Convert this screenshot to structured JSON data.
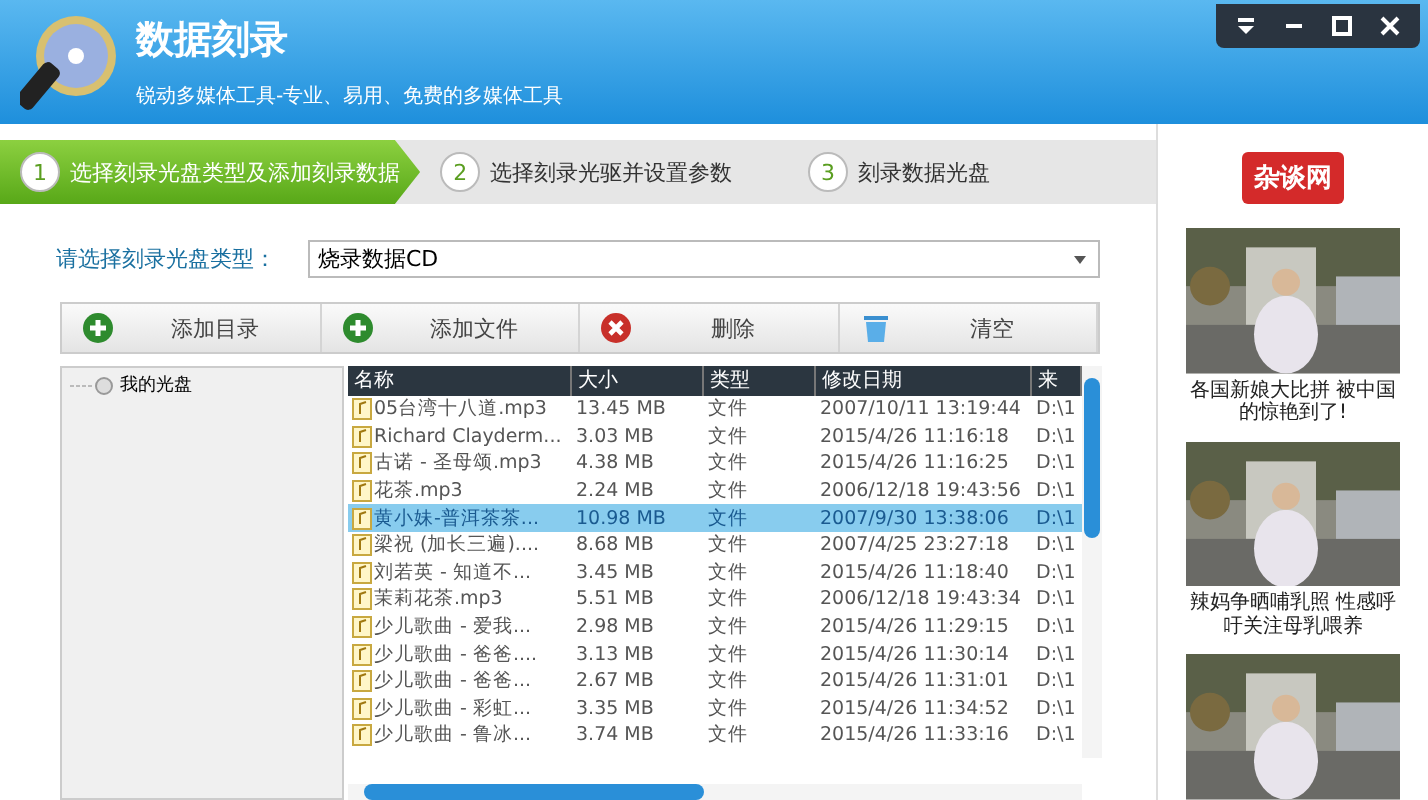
{
  "window": {
    "title": "数据刻录",
    "subtitle": "锐动多媒体工具-专业、易用、免费的多媒体工具"
  },
  "steps": [
    {
      "number": "1",
      "label": "选择刻录光盘类型及添加刻录数据",
      "selected": true
    },
    {
      "number": "2",
      "label": "选择刻录光驱并设置参数",
      "selected": false
    },
    {
      "number": "3",
      "label": "刻录数据光盘",
      "selected": false
    }
  ],
  "disc_type": {
    "label": "请选择刻录光盘类型：",
    "value": "烧录数据CD"
  },
  "toolbar": [
    {
      "kind": "add",
      "label": "添加目录"
    },
    {
      "kind": "add",
      "label": "添加文件"
    },
    {
      "kind": "delete",
      "label": "删除"
    },
    {
      "kind": "clear",
      "label": "清空"
    }
  ],
  "tree": {
    "items": [
      {
        "label": "我的光盘"
      }
    ]
  },
  "table": {
    "columns": [
      "名称",
      "大小",
      "类型",
      "修改日期",
      "来"
    ],
    "rows": [
      {
        "cells": [
          "05台湾十八道.mp3",
          "13.45 MB",
          "文件",
          "2007/10/11 13:19:44",
          "D:\\1"
        ],
        "selected": false
      },
      {
        "cells": [
          "Richard Clayderm...",
          "3.03 MB",
          "文件",
          "2015/4/26 11:16:18",
          "D:\\1"
        ],
        "selected": false
      },
      {
        "cells": [
          "古诺 - 圣母颂.mp3",
          "4.38 MB",
          "文件",
          "2015/4/26 11:16:25",
          "D:\\1"
        ],
        "selected": false
      },
      {
        "cells": [
          "花茶.mp3",
          "2.24 MB",
          "文件",
          "2006/12/18 19:43:56",
          "D:\\1"
        ],
        "selected": false
      },
      {
        "cells": [
          "黄小妹-普洱茶茶...",
          "10.98 MB",
          "文件",
          "2007/9/30 13:38:06",
          "D:\\1"
        ],
        "selected": true
      },
      {
        "cells": [
          "梁祝 (加长三遍)....",
          "8.68 MB",
          "文件",
          "2007/4/25 23:27:18",
          "D:\\1"
        ],
        "selected": false
      },
      {
        "cells": [
          "刘若英 - 知道不...",
          "3.45 MB",
          "文件",
          "2015/4/26 11:18:40",
          "D:\\1"
        ],
        "selected": false
      },
      {
        "cells": [
          "茉莉花茶.mp3",
          "5.51 MB",
          "文件",
          "2006/12/18 19:43:34",
          "D:\\1"
        ],
        "selected": false
      },
      {
        "cells": [
          "少儿歌曲 - 爱我...",
          "2.98 MB",
          "文件",
          "2015/4/26 11:29:15",
          "D:\\1"
        ],
        "selected": false
      },
      {
        "cells": [
          "少儿歌曲 - 爸爸....",
          "3.13 MB",
          "文件",
          "2015/4/26 11:30:14",
          "D:\\1"
        ],
        "selected": false
      },
      {
        "cells": [
          "少儿歌曲 - 爸爸...",
          "2.67 MB",
          "文件",
          "2015/4/26 11:31:01",
          "D:\\1"
        ],
        "selected": false
      },
      {
        "cells": [
          "少儿歌曲 - 彩虹...",
          "3.35 MB",
          "文件",
          "2015/4/26 11:34:52",
          "D:\\1"
        ],
        "selected": false
      },
      {
        "cells": [
          "少儿歌曲 - 鲁冰...",
          "3.74 MB",
          "文件",
          "2015/4/26 11:33:16",
          "D:\\1"
        ],
        "selected": false
      }
    ]
  },
  "ad": {
    "logo": "杂谈网",
    "items": [
      {
        "kind": "picture",
        "caption": "各国新娘大比拼 被中国的惊艳到了!"
      },
      {
        "kind": "picture",
        "caption": "辣妈争晒哺乳照 性感呼吁关注母乳喂养"
      },
      {
        "kind": "picture"
      }
    ]
  }
}
